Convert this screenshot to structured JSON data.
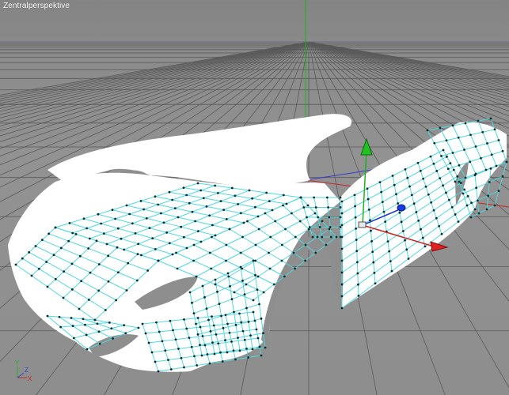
{
  "viewport": {
    "label": "Zentralperspektive",
    "background_color": "#8c8c8c",
    "grid_color": "#5a5a5a",
    "horizon_color": "#3a3a3a"
  },
  "scene": {
    "object": "car-body-mesh",
    "surface_color": "#ffffff",
    "wireframe_color": "#4fd8e0",
    "vertex_color": "#0b2a28"
  },
  "axes": {
    "y_axis_color": "#20b020",
    "x_axis_color": "#d02020",
    "z_axis_color": "#1a3adf",
    "world_x_color": "#c82828",
    "world_z_color": "#3a3acf"
  },
  "axis_indicator": {
    "x_label": "X",
    "y_label": "Y",
    "z_label": "Z",
    "x_color": "#c82828",
    "y_color": "#20b020",
    "z_color": "#2a4ad0"
  }
}
